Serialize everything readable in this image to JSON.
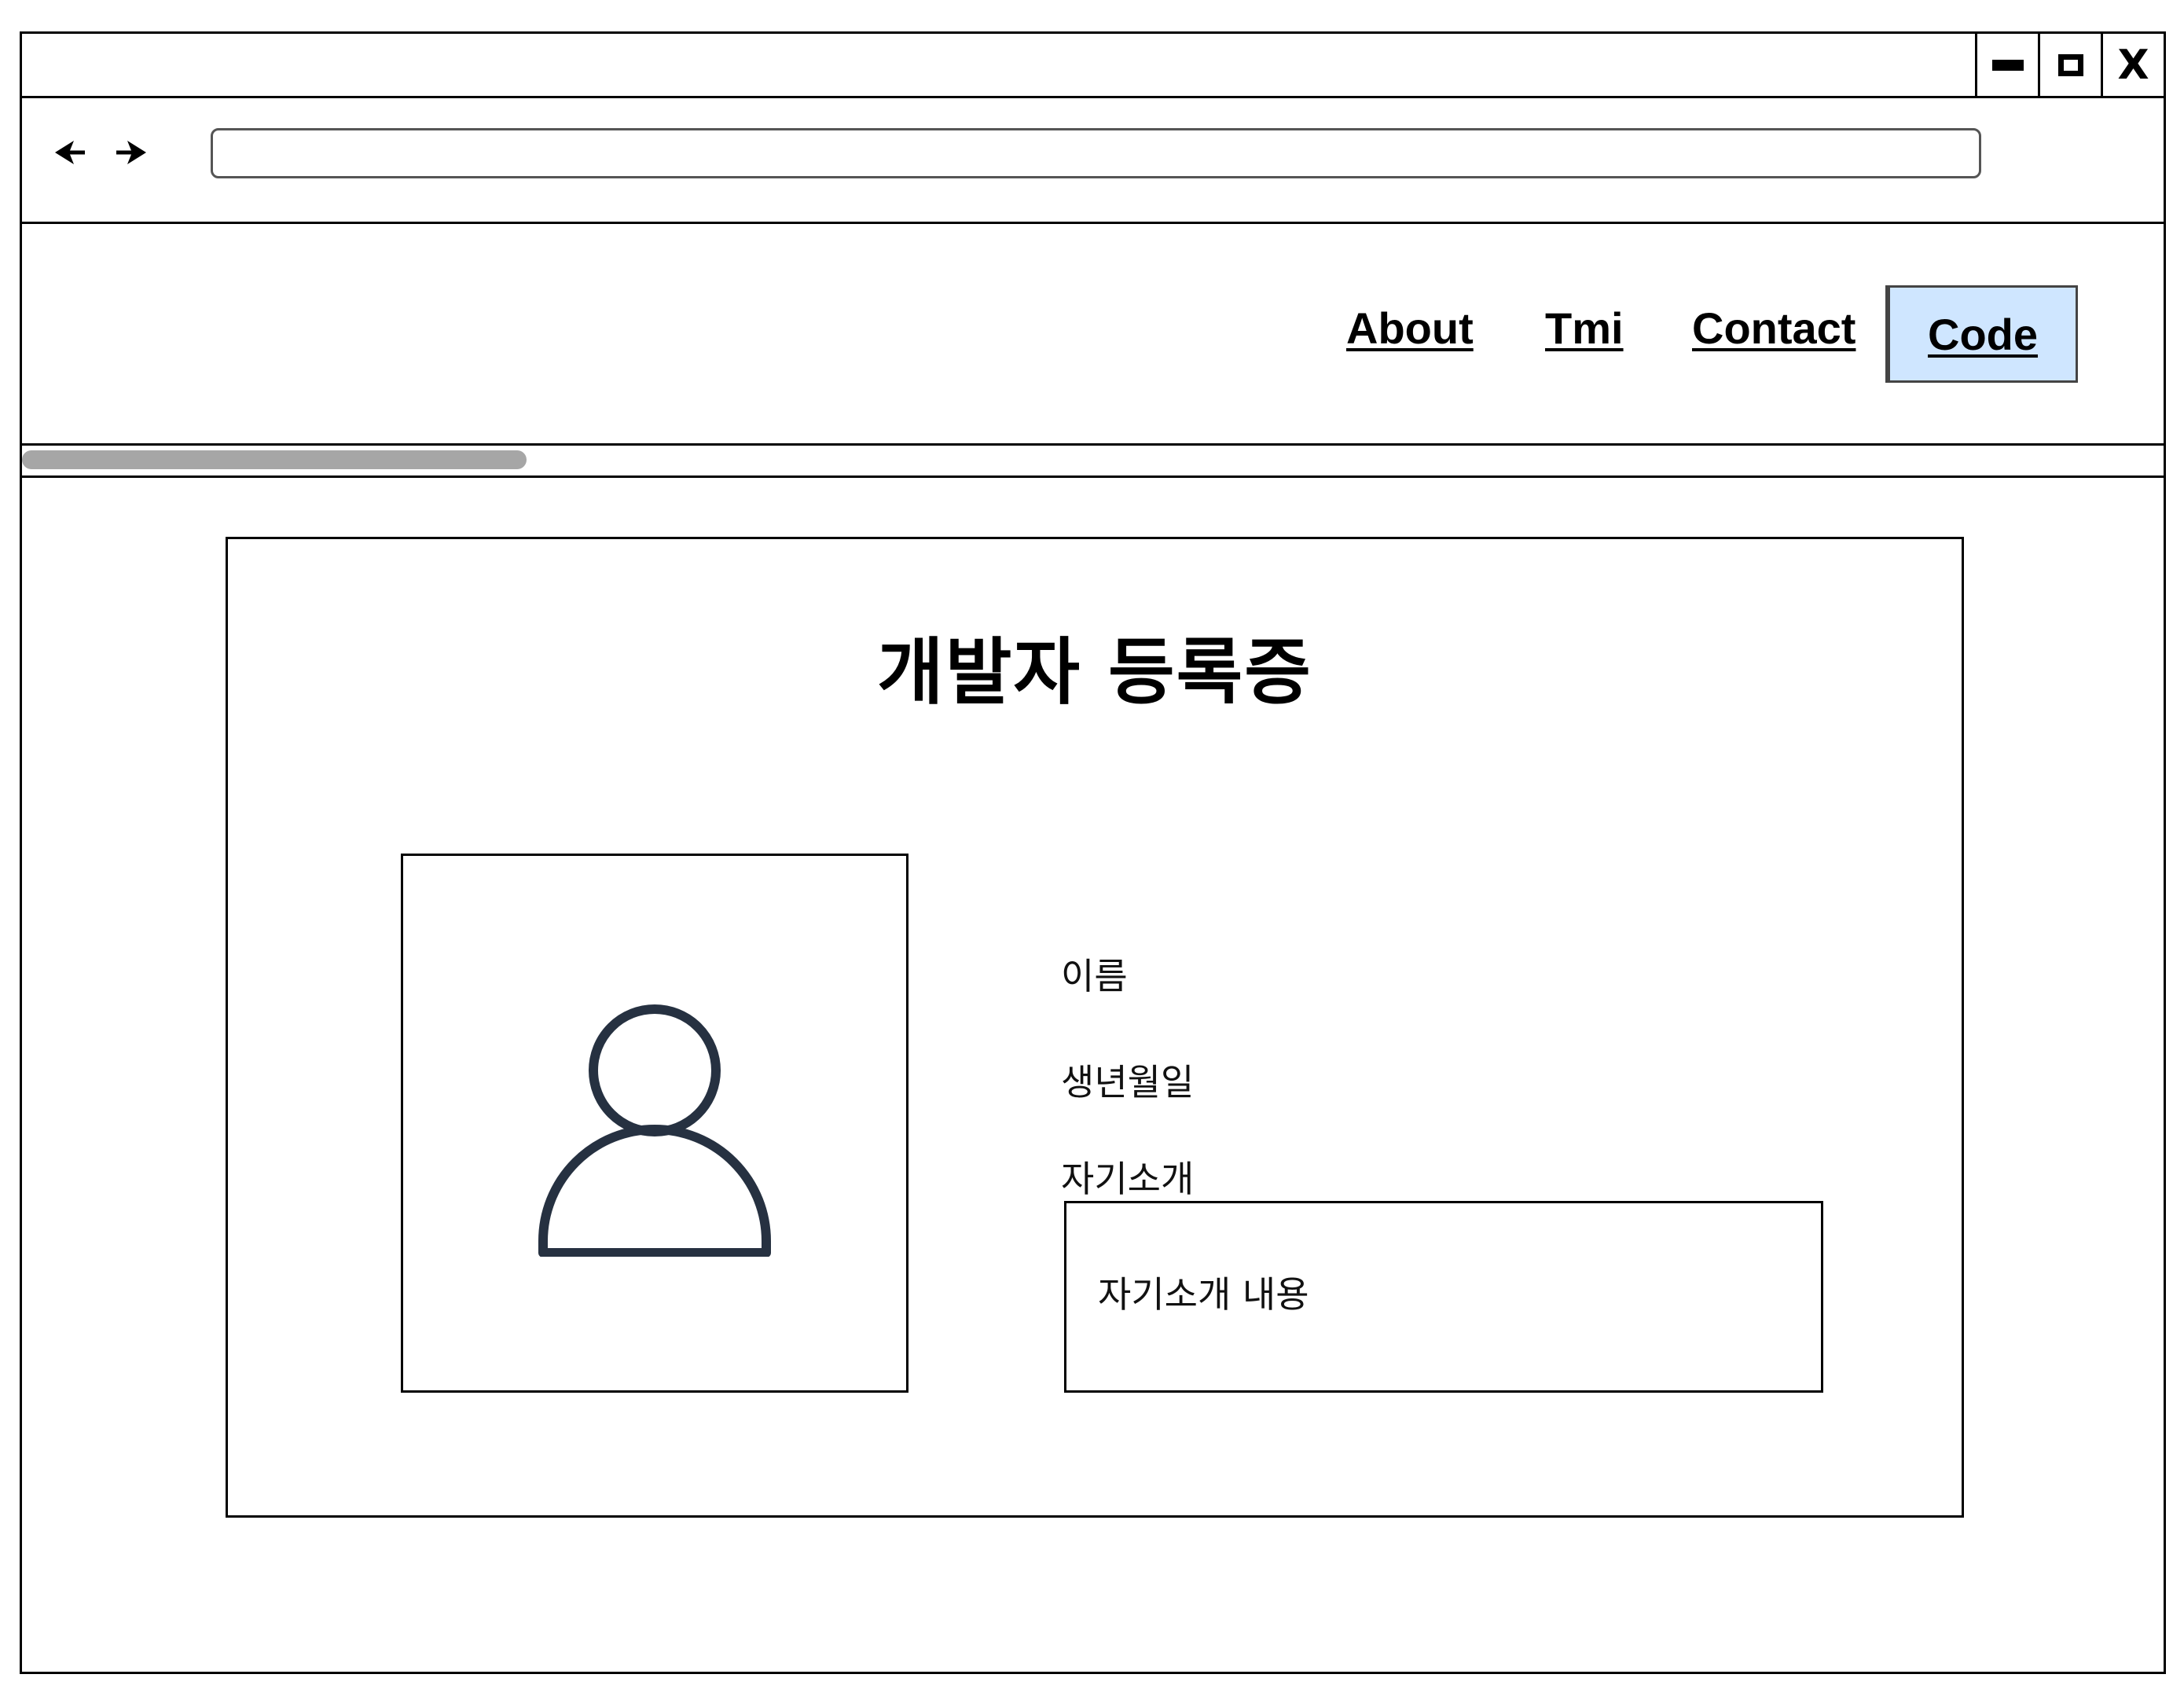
{
  "window_controls": {
    "minimize_icon": "minimize-icon",
    "maximize_icon": "maximize-icon",
    "close_label": "X"
  },
  "browser": {
    "back_icon": "arrow-left-icon",
    "forward_icon": "arrow-right-icon",
    "url_value": ""
  },
  "nav": {
    "items": [
      {
        "label": "About"
      },
      {
        "label": "Tmi"
      },
      {
        "label": "Contact"
      },
      {
        "label": "Code"
      }
    ],
    "active_color": "#cfe6ff"
  },
  "card": {
    "title": "개발자 등록증",
    "photo_icon": "user-avatar-icon",
    "fields": {
      "name_label": "이름",
      "birth_label": "생년월일",
      "intro_label": "자기소개",
      "intro_content": "자기소개 내용"
    }
  },
  "colors": {
    "border": "#000000",
    "scrollbar_thumb": "#a6a6a6",
    "avatar_stroke": "#263141"
  }
}
